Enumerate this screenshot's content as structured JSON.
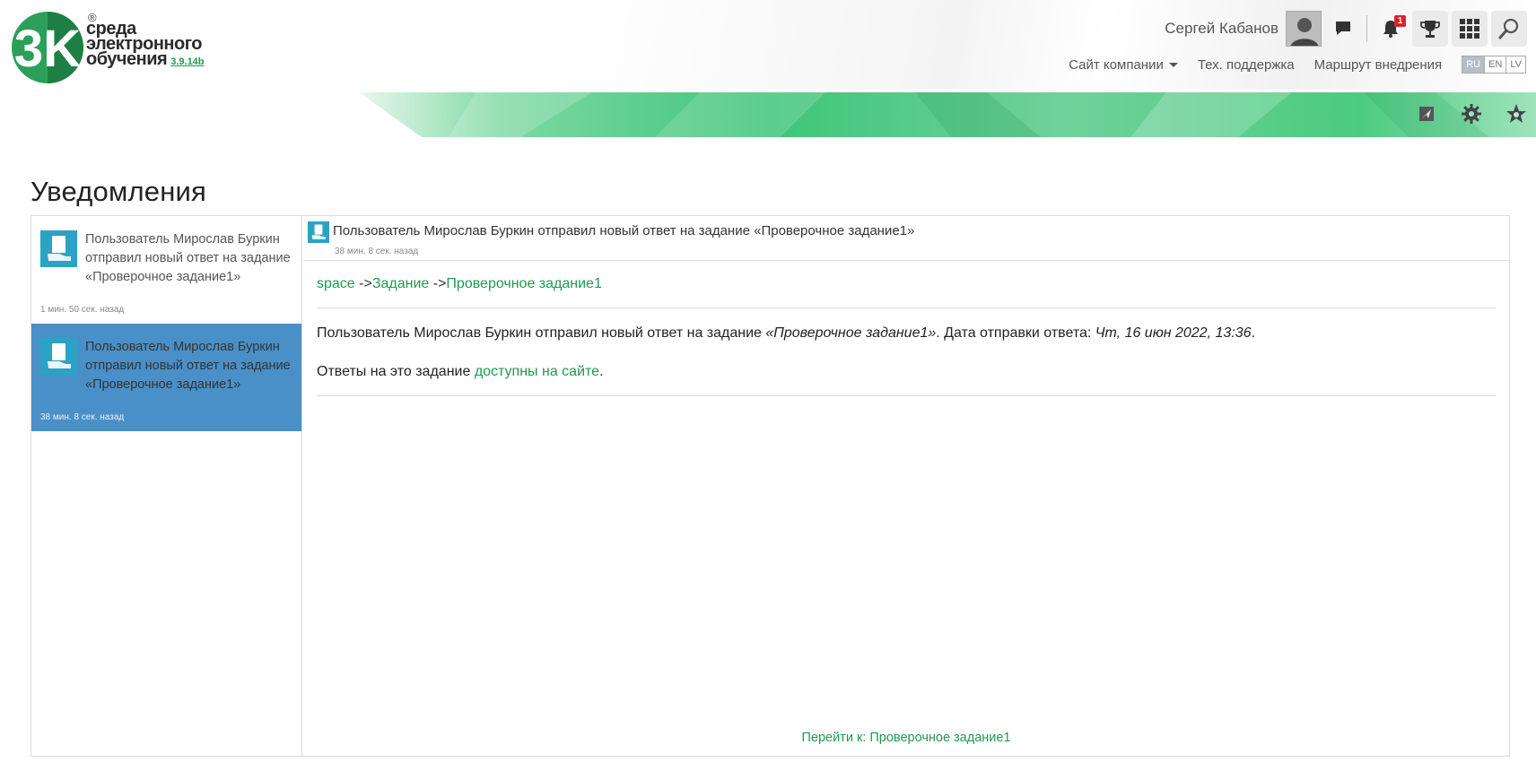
{
  "logo": {
    "line1": "среда",
    "line2": "электронного",
    "line3": "обучения",
    "version": "3.9.14b",
    "reg": "®",
    "mark": "3K"
  },
  "user": {
    "name": "Сергей Кабанов",
    "notifications_count": "1"
  },
  "icons": {
    "chat": "chat-icon",
    "bell": "bell-icon",
    "trophy": "trophy-icon",
    "apps": "grid-icon",
    "search": "search-icon",
    "send": "send-icon",
    "settings": "gear-icon",
    "favorites": "star-icon"
  },
  "nav": {
    "company_site": "Сайт компании",
    "support": "Тех. поддержка",
    "roadmap": "Маршрут внедрения",
    "languages": [
      "RU",
      "EN",
      "LV"
    ]
  },
  "page": {
    "title": "Уведомления"
  },
  "notifications": [
    {
      "text": "Пользователь Мирослав Буркин отправил новый ответ на задание «Проверочное задание1»",
      "time": "1 мин. 50 сек. назад",
      "active": false
    },
    {
      "text": "Пользователь Мирослав Буркин отправил новый ответ на задание «Проверочное задание1»",
      "time": "38 мин. 8 сек. назад",
      "active": true
    }
  ],
  "detail": {
    "title": "Пользователь Мирослав Буркин отправил новый ответ на задание «Проверочное задание1»",
    "time": "38 мин. 8 сек. назад",
    "crumb1": "space",
    "crumb_sep": " ->",
    "crumb2": "Задание",
    "crumb3": "Проверочное задание1",
    "msg_prefix": "Пользователь Мирослав Буркин отправил новый ответ на задание ",
    "msg_task": "«Проверочное задание1»",
    "msg_mid": ". Дата отправки ответа: ",
    "msg_date": "Чт, 16 июн 2022, 13:36",
    "msg_end": ".",
    "answers_prefix": "Ответы на это задание ",
    "answers_link": "доступны на сайте",
    "answers_end": ".",
    "goto": "Перейти к: Проверочное задание1"
  },
  "colors": {
    "brand_green": "#1e9b4f",
    "active_row": "#4a90c8",
    "badge": "#d9232e"
  }
}
